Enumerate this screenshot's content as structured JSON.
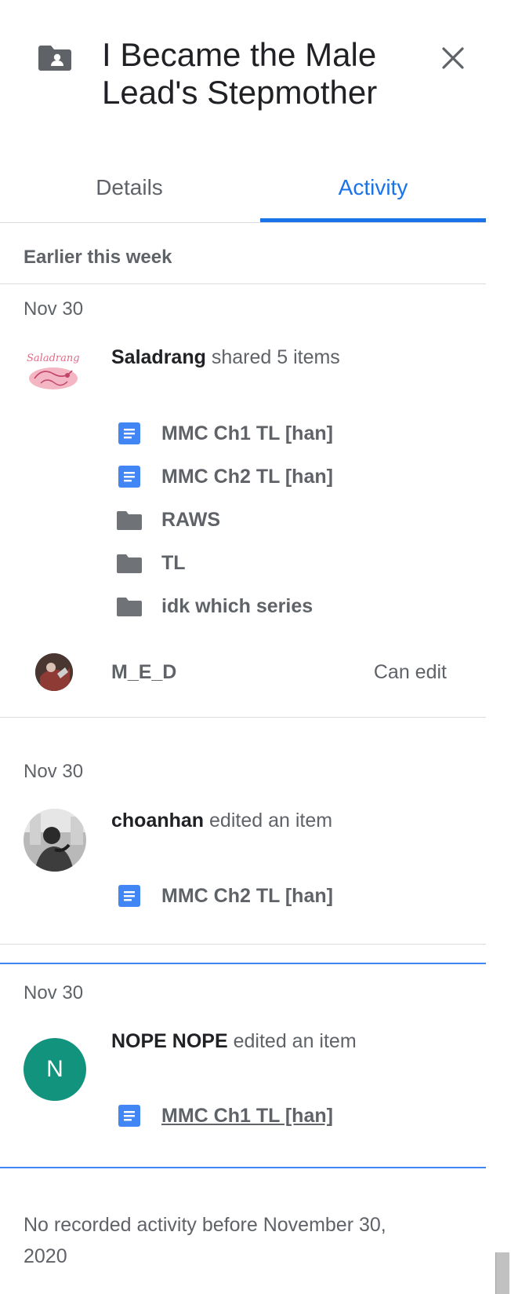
{
  "header": {
    "title": "I Became the Male Lead's Stepmother",
    "folder_icon": "shared-folder-icon",
    "close_icon": "close-icon"
  },
  "tabs": [
    {
      "label": "Details",
      "active": false
    },
    {
      "label": "Activity",
      "active": true
    }
  ],
  "colors": {
    "accent": "#1a73e8",
    "doc_icon": "#4285f4",
    "folder_icon": "#5f6368",
    "avatar_n": "#12937d"
  },
  "section": {
    "heading": "Earlier this week"
  },
  "activities": [
    {
      "date": "Nov 30",
      "actor": "Saladrang",
      "action": "shared 5 items",
      "avatar_text": "Saladrang",
      "items": [
        {
          "type": "doc",
          "label": "MMC Ch1 TL [han]"
        },
        {
          "type": "doc",
          "label": "MMC Ch2 TL [han]"
        },
        {
          "type": "folder",
          "label": "RAWS"
        },
        {
          "type": "folder",
          "label": "TL"
        },
        {
          "type": "folder",
          "label": "idk which series"
        }
      ],
      "shared_with": {
        "name": "M_E_D",
        "permission": "Can edit"
      }
    },
    {
      "date": "Nov 30",
      "actor": "choanhan",
      "action": "edited an item",
      "items": [
        {
          "type": "doc",
          "label": "MMC Ch2 TL [han]"
        }
      ]
    },
    {
      "date": "Nov 30",
      "actor": "NOPE NOPE",
      "action": "edited an item",
      "avatar_letter": "N",
      "items": [
        {
          "type": "doc",
          "label": "MMC Ch1 TL [han]"
        }
      ]
    }
  ],
  "footer": {
    "note": "No recorded activity before November 30, 2020"
  }
}
